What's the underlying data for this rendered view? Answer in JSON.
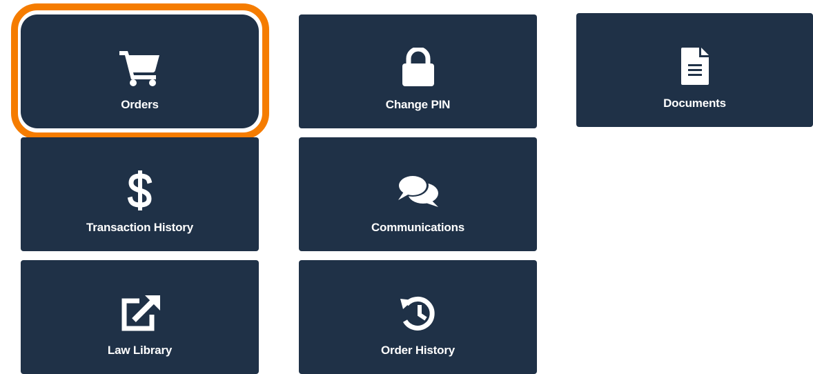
{
  "highlight": {
    "color": "#f57c00",
    "target": "Orders"
  },
  "colors": {
    "tile_background": "#1f3147",
    "tile_text": "#ffffff"
  },
  "tiles": {
    "orders": {
      "label": "Orders",
      "icon": "shopping-cart-icon"
    },
    "change_pin": {
      "label": "Change PIN",
      "icon": "lock-icon"
    },
    "documents": {
      "label": "Documents",
      "icon": "document-icon"
    },
    "transaction_history": {
      "label": "Transaction History",
      "icon": "dollar-sign-icon"
    },
    "communications": {
      "label": "Communications",
      "icon": "chat-bubbles-icon"
    },
    "law_library": {
      "label": "Law Library",
      "icon": "external-link-icon"
    },
    "order_history": {
      "label": "Order History",
      "icon": "history-icon"
    }
  }
}
